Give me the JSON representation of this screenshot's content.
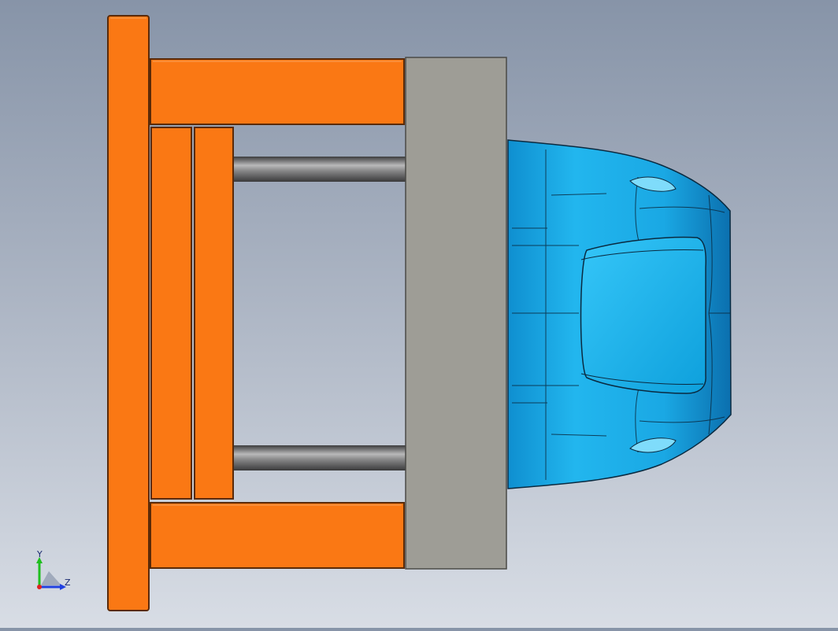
{
  "viewport": {
    "background_top": "#8794a8",
    "background_bottom": "#d8dde5",
    "colors": {
      "frame": "#fa7814",
      "frame_edge": "#5a2a08",
      "plate": "#9e9d96",
      "rod": "#6f6f70",
      "part": "#1aaee6",
      "part_edge": "#0a2a40"
    }
  },
  "triad": {
    "y_label": "Y",
    "z_label": "Z",
    "y_color": "#1fbf1f",
    "z_color": "#2040e0",
    "x_color": "#e02020"
  }
}
